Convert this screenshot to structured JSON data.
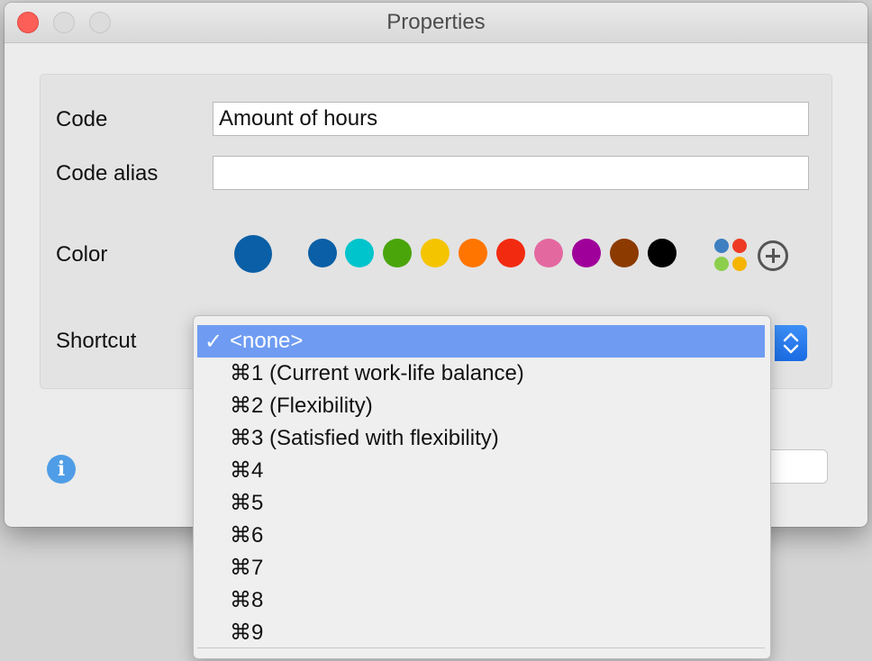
{
  "window": {
    "title": "Properties"
  },
  "form": {
    "code_label": "Code",
    "code_value": "Amount of hours",
    "alias_label": "Code alias",
    "alias_value": "",
    "color_label": "Color",
    "shortcut_label": "Shortcut"
  },
  "colors": {
    "selected": "#0a5fa6",
    "swatches": [
      "#0a5fa6",
      "#00c4cc",
      "#4aa50a",
      "#f5c400",
      "#ff7500",
      "#f22a10",
      "#e468a0",
      "#a0009a",
      "#8c3a00",
      "#000000"
    ],
    "palette_icon_colors": [
      "#3d7fc0",
      "#ee3a24",
      "#8ccf4d",
      "#f5b400"
    ],
    "menu_highlight": "#6f9cf2"
  },
  "shortcut_menu": {
    "check_mark": "✓",
    "items": [
      "<none>",
      "⌘1 (Current work-life balance)",
      "⌘2 (Flexibility)",
      "⌘3 (Satisfied with flexibility)",
      "⌘4",
      "⌘5",
      "⌘6",
      "⌘7",
      "⌘8",
      "⌘9"
    ],
    "selected_index": 0
  },
  "icons": {
    "info": "info-icon",
    "add": "plus-circle-icon",
    "palette": "color-palette-icon",
    "stepper": "chevron-updown-icon"
  },
  "info_glyph": "i"
}
